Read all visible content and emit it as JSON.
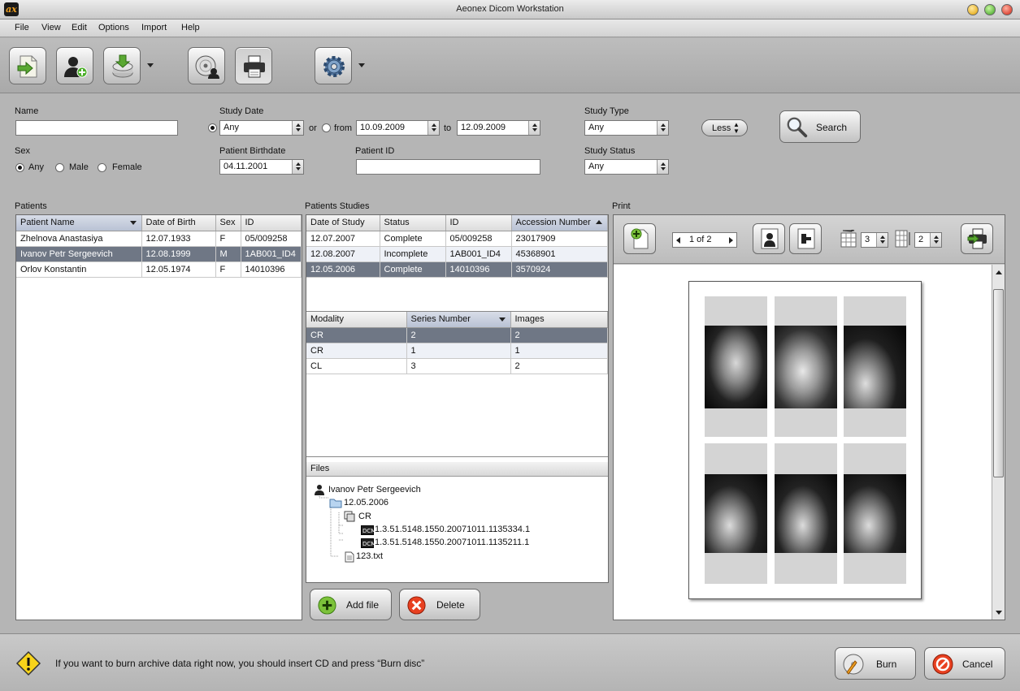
{
  "window": {
    "title": "Aeonex Dicom Workstation",
    "logo_text": "ax"
  },
  "menu": [
    "File",
    "View",
    "Edit",
    "Options",
    "Import",
    "Help"
  ],
  "toolbar": {
    "buttons": [
      "import-icon",
      "add-patient-icon",
      "database-download-icon",
      "burn-disc-icon",
      "printer-icon",
      "settings-gear-icon"
    ]
  },
  "filters": {
    "name_label": "Name",
    "name_value": "",
    "study_date_label": "Study Date",
    "study_date_value": "Any",
    "or_label": "or",
    "from_label": "from",
    "from_value": "10.09.2009",
    "to_label": "to",
    "to_value": "12.09.2009",
    "study_type_label": "Study Type",
    "study_type_value": "Any",
    "less_label": "Less",
    "search_label": "Search",
    "sex_label": "Sex",
    "sex_options": [
      "Any",
      "Male",
      "Female"
    ],
    "sex_selected": "Any",
    "birthdate_label": "Patient Birthdate",
    "birthdate_value": "04.11.2001",
    "patient_id_label": "Patient ID",
    "patient_id_value": "",
    "study_status_label": "Study Status",
    "study_status_value": "Any"
  },
  "patients": {
    "title": "Patients",
    "columns": [
      "Patient Name",
      "Date of Birth",
      "Sex",
      "ID"
    ],
    "rows": [
      [
        "Zhelnova Anastasiya",
        "12.07.1933",
        "F",
        "05/009258"
      ],
      [
        "Ivanov Petr Sergeevich",
        "12.08.1999",
        "M",
        "1AB001_ID4"
      ],
      [
        "Orlov Konstantin",
        "12.05.1974",
        "F",
        "14010396"
      ]
    ],
    "selected_row": 1
  },
  "studies": {
    "title": "Patients Studies",
    "columns": [
      "Date of Study",
      "Status",
      "ID",
      "Accession Number"
    ],
    "rows": [
      [
        "12.07.2007",
        "Complete",
        "05/009258",
        "23017909"
      ],
      [
        "12.08.2007",
        "Incomplete",
        "1AB001_ID4",
        "45368901"
      ],
      [
        "12.05.2006",
        "Complete",
        "14010396",
        "3570924"
      ]
    ],
    "selected_row": 2
  },
  "series": {
    "columns": [
      "Modality",
      "Series Number",
      "Images"
    ],
    "rows": [
      [
        "CR",
        "2",
        "2"
      ],
      [
        "CR",
        "1",
        "1"
      ],
      [
        "CL",
        "3",
        "2"
      ]
    ],
    "selected_row": 0
  },
  "files": {
    "title": "Files",
    "tree": {
      "patient": "Ivanov Petr Sergeevich",
      "study": "12.05.2006",
      "series": "CR",
      "files": [
        "1.3.51.5148.1550.20071011.1135334.1",
        "1.3.51.5148.1550.20071011.1135211.1"
      ],
      "other_file": "123.txt"
    }
  },
  "file_actions": {
    "add_label": "Add file",
    "delete_label": "Delete"
  },
  "print": {
    "title": "Print",
    "page_indicator": "1 of 2",
    "columns_value": "3",
    "rows_value": "2"
  },
  "status": {
    "message": "If you want to burn archive data right now, you should insert CD and press “Burn disc”",
    "burn_label": "Burn",
    "cancel_label": "Cancel"
  }
}
